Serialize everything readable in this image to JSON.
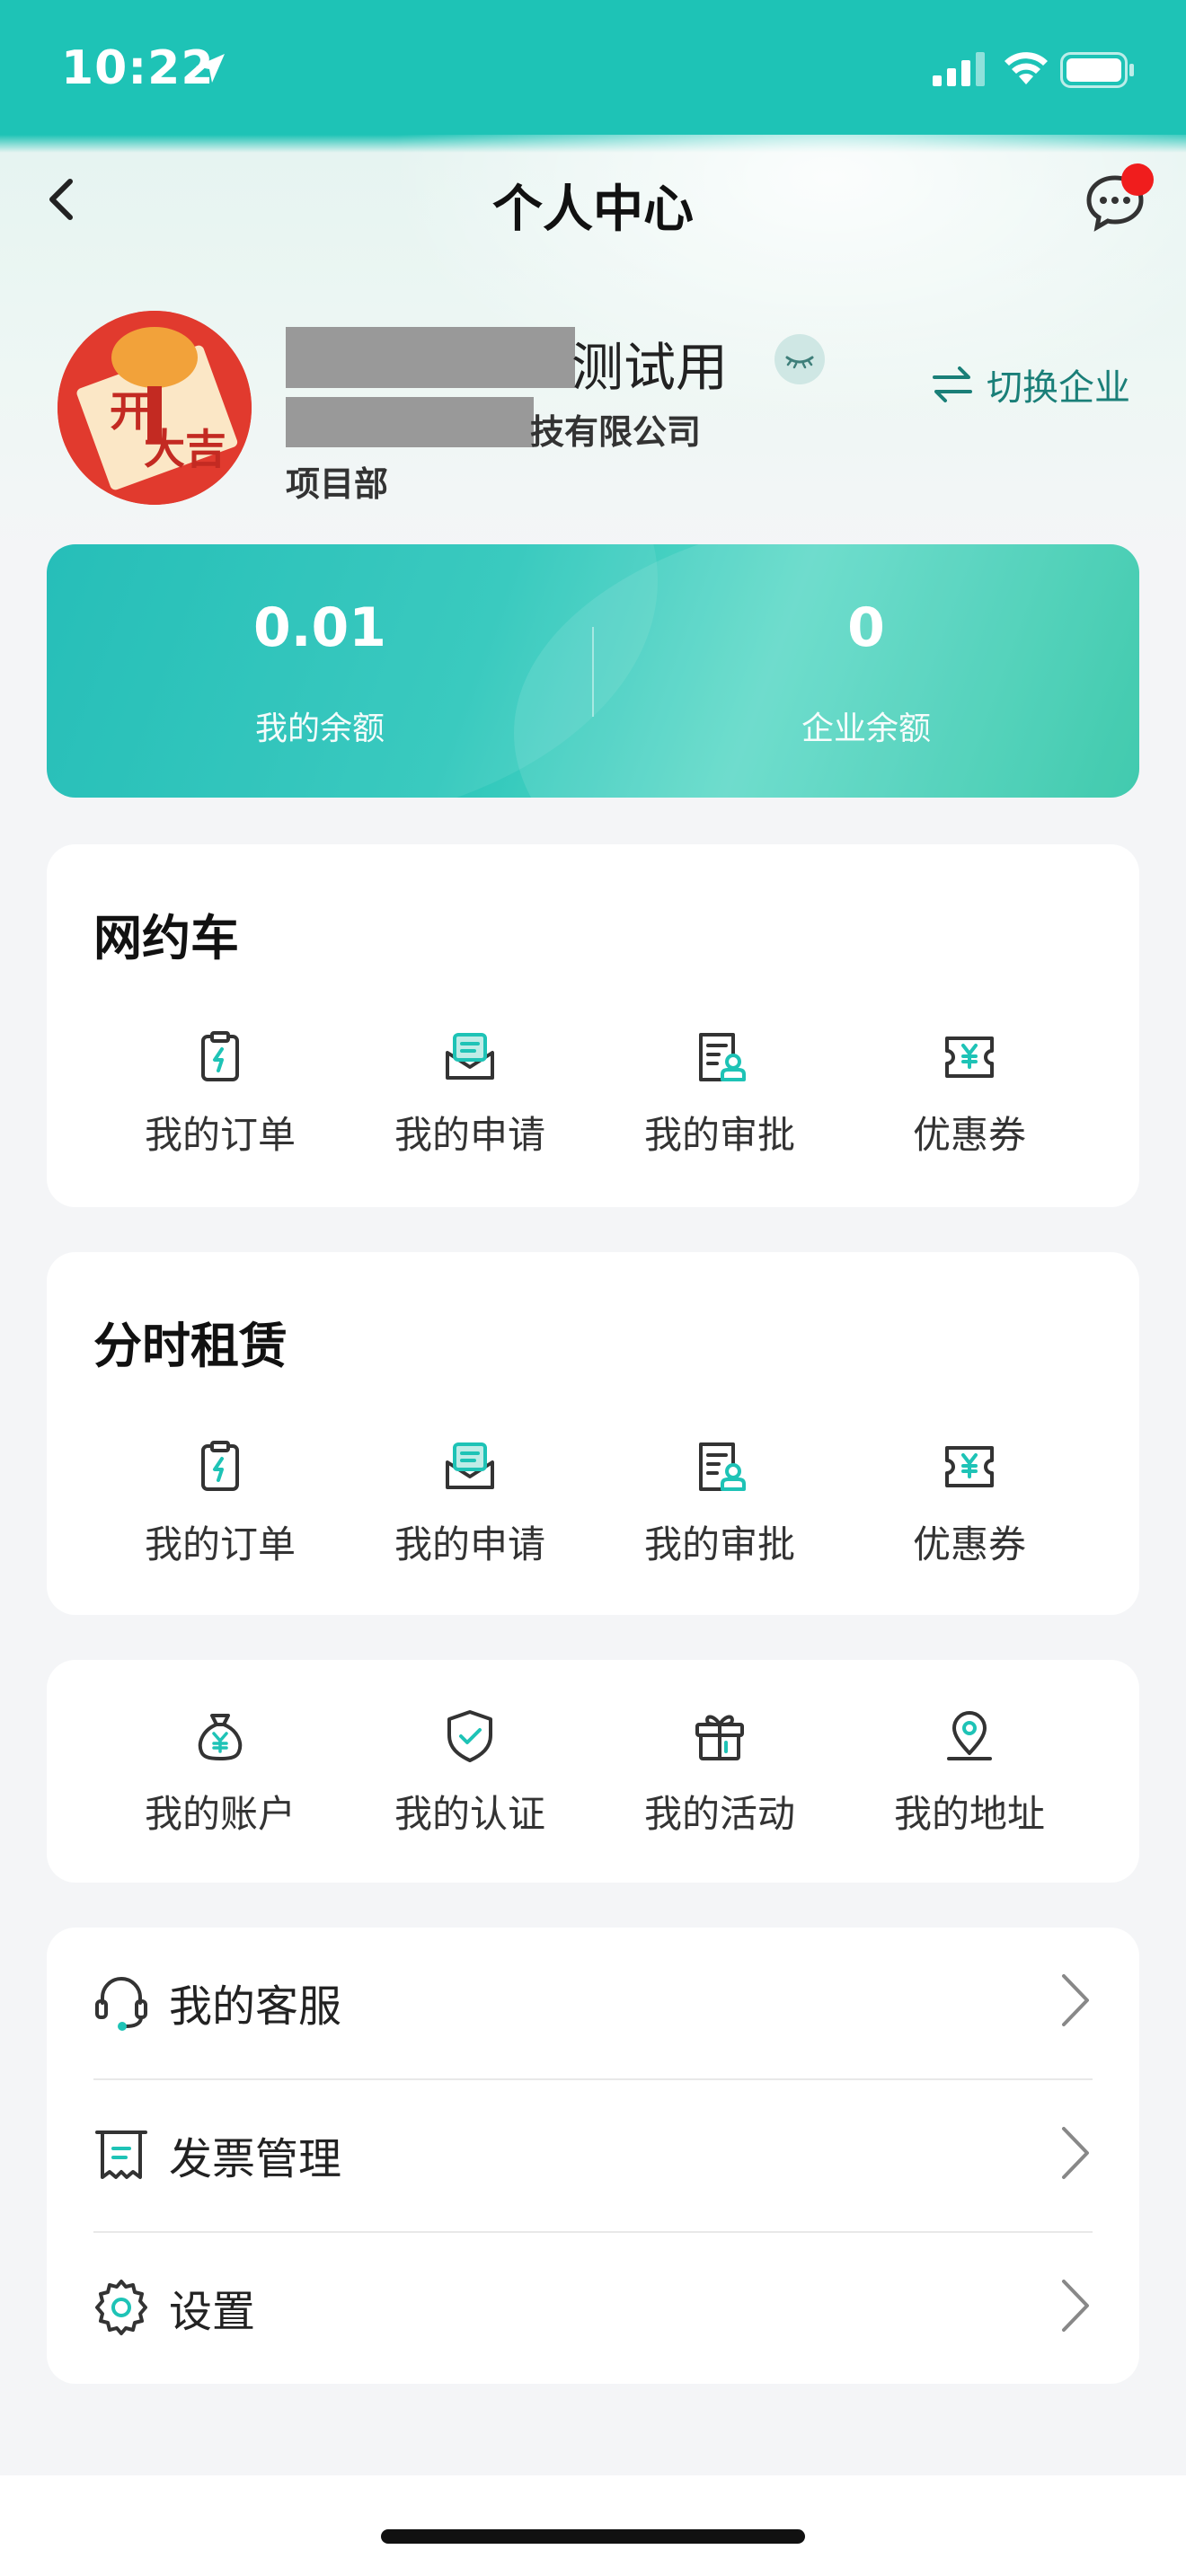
{
  "status_bar": {
    "time": "10:22"
  },
  "nav": {
    "title": "个人中心"
  },
  "profile": {
    "name_visible": "测试用",
    "company_visible": "技有限公司",
    "department": "项目部",
    "switch_label": "切换企业"
  },
  "balance": {
    "mine": {
      "value": "0.01",
      "label": "我的余额"
    },
    "enterprise": {
      "value": "0",
      "label": "企业余额"
    }
  },
  "ride_hailing": {
    "title": "网约车",
    "items": [
      {
        "label": "我的订单",
        "icon": "order-icon"
      },
      {
        "label": "我的申请",
        "icon": "application-icon"
      },
      {
        "label": "我的审批",
        "icon": "approval-icon"
      },
      {
        "label": "优惠券",
        "icon": "coupon-icon"
      }
    ]
  },
  "rental": {
    "title": "分时租赁",
    "items": [
      {
        "label": "我的订单",
        "icon": "order-icon"
      },
      {
        "label": "我的申请",
        "icon": "application-icon"
      },
      {
        "label": "我的审批",
        "icon": "approval-icon"
      },
      {
        "label": "优惠券",
        "icon": "coupon-icon"
      }
    ]
  },
  "account": {
    "items": [
      {
        "label": "我的账户",
        "icon": "money-bag-icon"
      },
      {
        "label": "我的认证",
        "icon": "shield-check-icon"
      },
      {
        "label": "我的活动",
        "icon": "gift-icon"
      },
      {
        "label": "我的地址",
        "icon": "location-pin-icon"
      }
    ]
  },
  "menu": {
    "items": [
      {
        "label": "我的客服",
        "icon": "headset-icon"
      },
      {
        "label": "发票管理",
        "icon": "invoice-icon"
      },
      {
        "label": "设置",
        "icon": "settings-icon"
      }
    ]
  },
  "colors": {
    "accent": "#1ec3b6",
    "accent_dark": "#1a7f78",
    "badge": "#f01d1d"
  }
}
